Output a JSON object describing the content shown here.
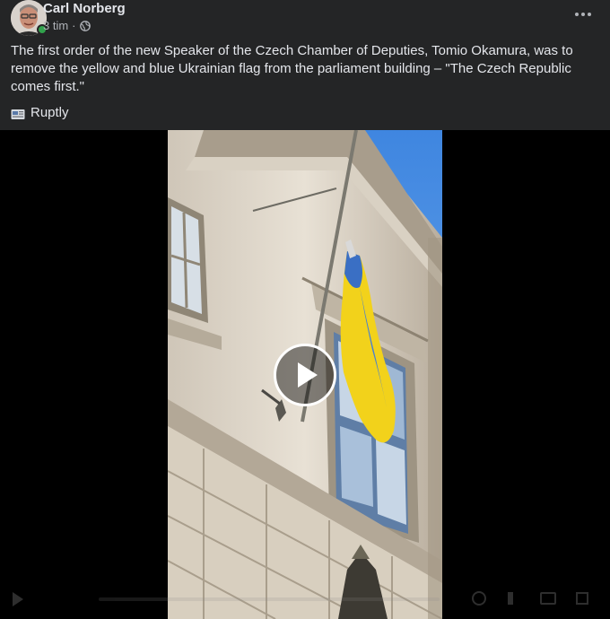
{
  "post": {
    "author": "Carl Norberg",
    "timestamp": "3 tim",
    "separator": "·",
    "privacy_icon": "globe-icon",
    "more_icon": "more-options-icon",
    "text": "The first order of the new Speaker of the Czech Chamber of Deputies, Tomio Okamura, was to remove the yellow and blue Ukrainian flag from the parliament building – \"The Czech Republic comes first.\"",
    "source_icon": "newspaper-icon",
    "source_label": "Ruptly"
  },
  "video": {
    "play_icon": "play-icon",
    "subject": "Ukrainian flag on parliament building facade"
  },
  "colors": {
    "background": "#242526",
    "text": "#e4e6eb",
    "secondary_text": "#b0b3b8",
    "online": "#31a24c",
    "flag_blue": "#3a6fc4",
    "flag_yellow": "#f2d21b"
  }
}
